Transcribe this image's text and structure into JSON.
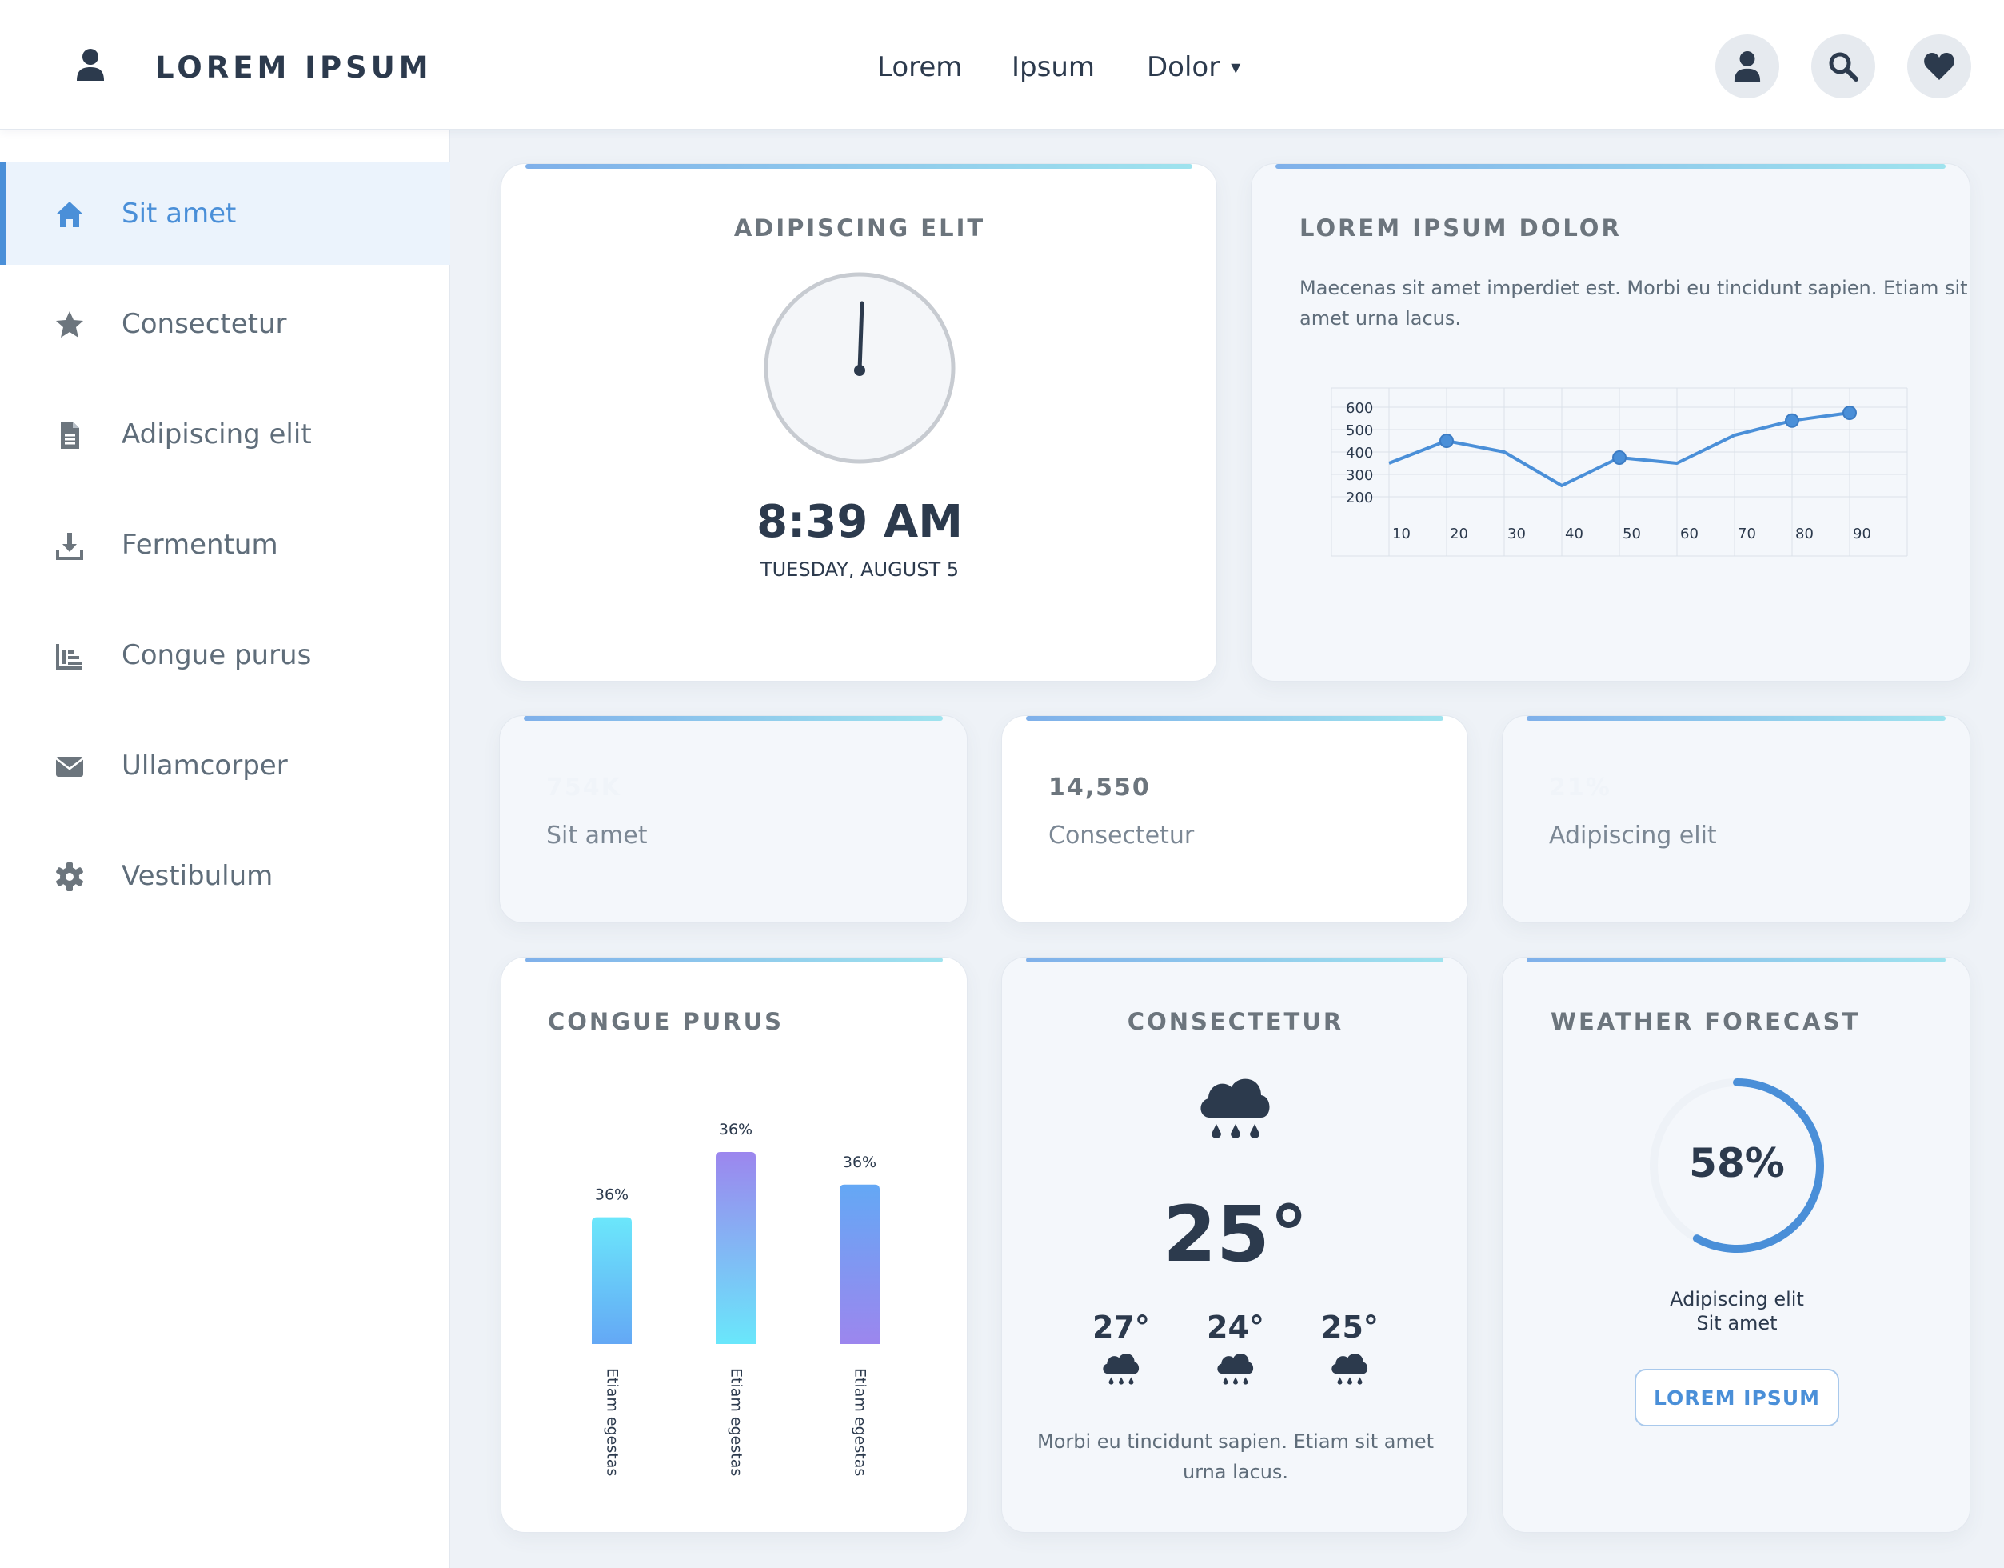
{
  "header": {
    "brand": "LOREM IPSUM",
    "nav": [
      {
        "label": "Lorem"
      },
      {
        "label": "Ipsum"
      },
      {
        "label": "Dolor"
      }
    ],
    "dropdown_arrow": "▾",
    "icons": [
      "user-icon",
      "search-icon",
      "heart-icon"
    ]
  },
  "sidebar": {
    "items": [
      {
        "label": "Sit amet",
        "icon": "home-icon",
        "active": true
      },
      {
        "label": "Consectetur",
        "icon": "star-icon"
      },
      {
        "label": "Adipiscing elit",
        "icon": "document-icon"
      },
      {
        "label": "Fermentum",
        "icon": "download-icon"
      },
      {
        "label": "Congue purus",
        "icon": "bar-chart-icon"
      },
      {
        "label": "Ullamcorper",
        "icon": "envelope-icon"
      },
      {
        "label": "Vestibulum",
        "icon": "gear-icon"
      }
    ]
  },
  "clock": {
    "title": "ADIPISCING ELIT",
    "time": "8:39 AM",
    "date": "TUESDAY, AUGUST 5"
  },
  "line_card": {
    "title": "LOREM IPSUM DOLOR",
    "description_line1": "Maecenas sit amet imperdiet est. Morbi eu tincidunt sapien. Etiam sit",
    "description_line2": "amet urna lacus."
  },
  "chart_data": [
    {
      "type": "line",
      "x": [
        10,
        20,
        30,
        40,
        50,
        60,
        70,
        80,
        90
      ],
      "series": [
        {
          "values": [
            350,
            450,
            400,
            250,
            375,
            350,
            475,
            540,
            575
          ],
          "markers_at": [
            20,
            50,
            80,
            90
          ]
        }
      ],
      "y_ticks": [
        200,
        300,
        400,
        500,
        600
      ],
      "x_ticks": [
        10,
        20,
        30,
        40,
        50,
        60,
        70,
        80,
        90
      ],
      "ylim": [
        150,
        650
      ],
      "xlim": [
        0,
        100
      ],
      "grid": true,
      "color": "#4a8fd8"
    },
    {
      "type": "bar",
      "categories": [
        "Etiam egestas",
        "Etiam egestas",
        "Etiam egestas"
      ],
      "values": [
        36,
        36,
        36
      ],
      "value_labels": [
        "36%",
        "36%",
        "36%"
      ],
      "relative_heights": [
        0.66,
        1.0,
        0.83
      ],
      "colors": [
        [
          "#6be7fb",
          "#64a8f5"
        ],
        [
          "#9c86ee",
          "#69e7fb"
        ],
        [
          "#64a8f5",
          "#9c86ee"
        ]
      ]
    }
  ],
  "stats": [
    {
      "value": "754K",
      "label": "Sit amet"
    },
    {
      "value": "14,550",
      "label": "Consectetur"
    },
    {
      "value": "21%",
      "label": "Adipiscing elit"
    }
  ],
  "bar_card": {
    "title": "CONGUE PURUS"
  },
  "weather_card": {
    "title": "CONSECTETUR",
    "temperature": "25°",
    "forecast": [
      {
        "temp": "27°",
        "icon": "rain-cloud-icon"
      },
      {
        "temp": "24°",
        "icon": "rain-cloud-icon"
      },
      {
        "temp": "25°",
        "icon": "rain-cloud-icon"
      }
    ],
    "description_line1": "Morbi eu tincidunt sapien. Etiam sit amet",
    "description_line2": "urna lacus."
  },
  "forecast_card": {
    "title": "WEATHER FORECAST",
    "percent": "58%",
    "progress": 0.58,
    "line1": "Adipiscing elit",
    "line2": "Sit amet",
    "button": "LOREM IPSUM"
  },
  "colors": {
    "accent": "#4a8fd8",
    "dark": "#2c3a4d",
    "muted": "#6c757d"
  }
}
